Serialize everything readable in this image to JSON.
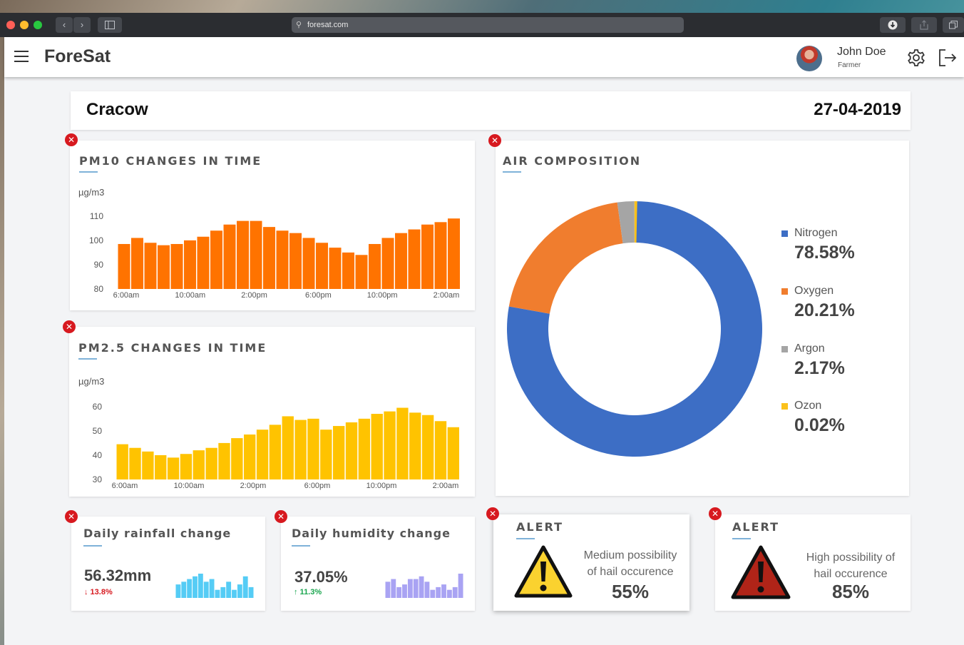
{
  "browser": {
    "url": "foresat.com",
    "colors": {
      "close": "#fe5f57",
      "minimize": "#febc2e",
      "maximize": "#28c840"
    }
  },
  "header": {
    "brand": "ForeSat",
    "user": {
      "name": "John Doe",
      "role": "Farmer"
    }
  },
  "location": {
    "city": "Cracow",
    "date": "27-04-2019"
  },
  "pm10": {
    "title": "PM10 CHANGES IN TIME",
    "unit": "µg/m3",
    "color": "#ff7300",
    "chart_data": {
      "type": "bar",
      "title": "PM10 CHANGES IN TIME",
      "ylabel": "µg/m3",
      "yticks": [
        80,
        90,
        100,
        110
      ],
      "ylim": [
        80,
        112
      ],
      "xticks": [
        "6:00am",
        "10:00am",
        "2:00pm",
        "6:00pm",
        "10:00pm",
        "2:00am"
      ],
      "values": [
        98.5,
        101,
        99,
        98,
        98.5,
        100,
        101.5,
        104,
        106.5,
        108,
        108,
        105.5,
        104,
        103,
        101,
        99,
        97,
        95,
        94,
        98.5,
        101,
        103,
        104.5,
        106.5,
        107.5,
        109
      ]
    }
  },
  "pm25": {
    "title": "PM2.5 CHANGES IN TIME",
    "unit": "µg/m3",
    "color": "#ffc300",
    "chart_data": {
      "type": "bar",
      "title": "PM2.5 CHANGES IN TIME",
      "ylabel": "µg/m3",
      "yticks": [
        30,
        40,
        50,
        60
      ],
      "ylim": [
        30,
        62
      ],
      "xticks": [
        "6:00am",
        "10:00am",
        "2:00pm",
        "6:00pm",
        "10:00pm",
        "2:00am"
      ],
      "values": [
        44.5,
        43,
        41.5,
        40,
        39,
        40.5,
        42,
        43,
        45,
        47,
        48.5,
        50.5,
        52.5,
        56,
        54.5,
        55,
        50.5,
        52,
        53.5,
        55,
        57,
        58,
        59.5,
        57.5,
        56.5,
        54,
        51.5
      ]
    }
  },
  "air": {
    "title": "AIR COMPOSITION",
    "chart_data": {
      "type": "pie",
      "title": "AIR COMPOSITION",
      "categories": [
        "Nitrogen",
        "Oxygen",
        "Argon",
        "Ozon"
      ],
      "values": [
        78.58,
        20.21,
        2.17,
        0.02
      ],
      "colors": [
        "#3d6ec5",
        "#f07d2e",
        "#a5a5a5",
        "#fbc11b"
      ]
    },
    "legend": [
      {
        "label": "Nitrogen",
        "value": "78.58%"
      },
      {
        "label": "Oxygen",
        "value": "20.21%"
      },
      {
        "label": "Argon",
        "value": "2.17%"
      },
      {
        "label": "Ozon",
        "value": "0.02%"
      }
    ]
  },
  "rainfall": {
    "title": "Daily rainfall change",
    "value": "56.32mm",
    "delta": "↓ 13.8%",
    "delta_color": "#d7191f",
    "color": "#55ccf5",
    "chart_data": {
      "type": "bar",
      "values": [
        5,
        6,
        7,
        8,
        9,
        6,
        7,
        3,
        4,
        6,
        3,
        5,
        8,
        4
      ]
    }
  },
  "humidity": {
    "title": "Daily humidity change",
    "value": "37.05%",
    "delta": "↑ 11.3%",
    "delta_color": "#1aa64f",
    "color": "#a9a3f3",
    "chart_data": {
      "type": "bar",
      "values": [
        6,
        7,
        4,
        5,
        7,
        7,
        8,
        6,
        3,
        4,
        5,
        3,
        4,
        9
      ]
    }
  },
  "alert1": {
    "title": "ALERT",
    "text_line1": "Medium possibility",
    "text_line2": "of hail occurence",
    "pct": "55%",
    "color": "#fad22f"
  },
  "alert2": {
    "title": "ALERT",
    "text_line1": "High possibility of",
    "text_line2": "hail occurence",
    "pct": "85%",
    "color": "#b02418"
  }
}
